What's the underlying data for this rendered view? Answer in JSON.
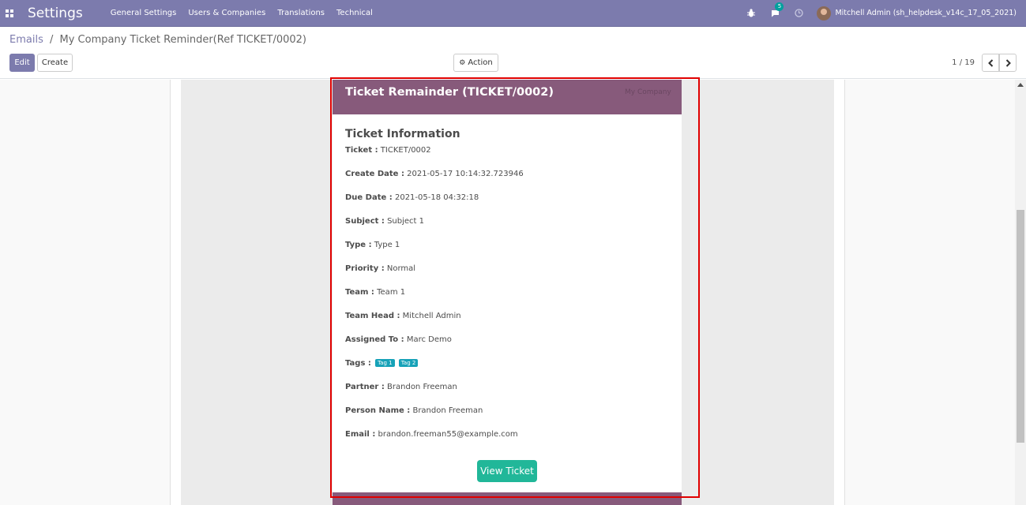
{
  "navbar": {
    "brand": "Settings",
    "menu": [
      "General Settings",
      "Users & Companies",
      "Translations",
      "Technical"
    ],
    "messages_count": "5",
    "user": "Mitchell Admin (sh_helpdesk_v14c_17_05_2021)"
  },
  "breadcrumb": {
    "parent": "Emails",
    "separator": "/",
    "current": "My Company Ticket Reminder(Ref TICKET/0002)"
  },
  "buttons": {
    "edit": "Edit",
    "create": "Create",
    "action": "Action"
  },
  "pager": {
    "value": "1 / 19"
  },
  "email": {
    "title": "Ticket Remainder (TICKET/0002)",
    "logo": "My Company",
    "section_title": "Ticket Information",
    "fields": [
      {
        "label": "Ticket :",
        "value": "TICKET/0002"
      },
      {
        "label": "Create Date :",
        "value": "2021-05-17 10:14:32.723946"
      },
      {
        "label": "Due Date :",
        "value": "2021-05-18 04:32:18"
      },
      {
        "label": "Subject :",
        "value": "Subject 1"
      },
      {
        "label": "Type :",
        "value": "Type 1"
      },
      {
        "label": "Priority :",
        "value": "Normal"
      },
      {
        "label": "Team :",
        "value": "Team 1"
      },
      {
        "label": "Team Head :",
        "value": "Mitchell Admin"
      },
      {
        "label": "Assigned To :",
        "value": "Marc Demo"
      },
      {
        "label": "Tags :",
        "value": ""
      },
      {
        "label": "Partner :",
        "value": "Brandon Freeman"
      },
      {
        "label": "Person Name :",
        "value": "Brandon Freeman"
      },
      {
        "label": "Email :",
        "value": "brandon.freeman55@example.com"
      }
    ],
    "tags": [
      "Tag 1",
      "Tag 2"
    ],
    "view_button": "View Ticket"
  },
  "colors": {
    "navbar": "#7c7bad",
    "email_header": "#875a7b",
    "view_button": "#21b799",
    "tag": "#17a2b8",
    "highlight": "#e00000"
  }
}
